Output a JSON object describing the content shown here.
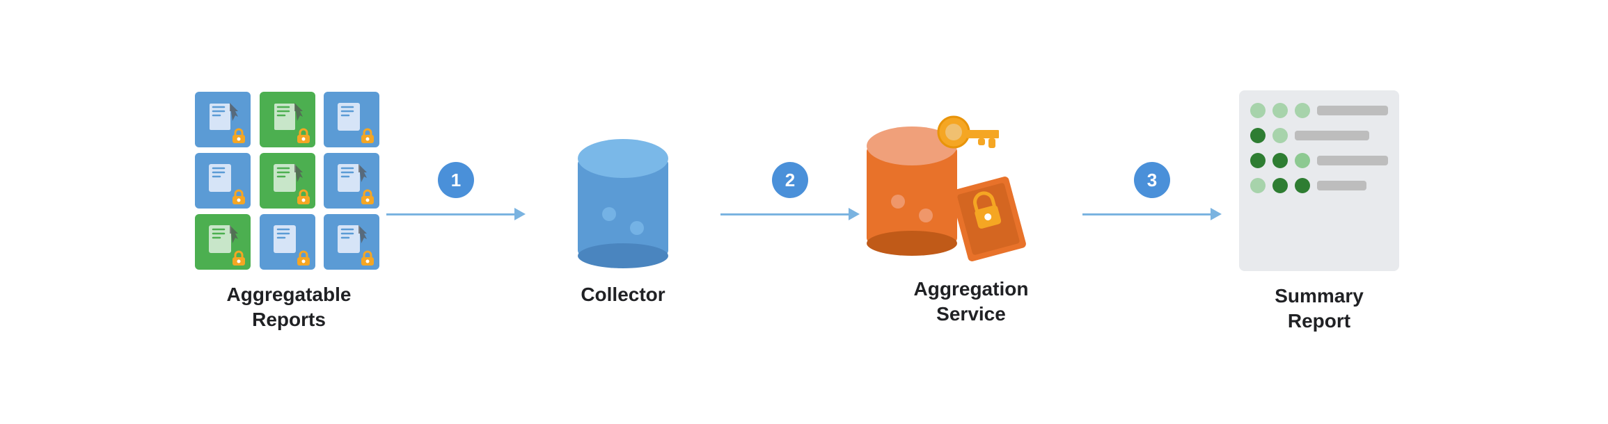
{
  "diagram": {
    "nodes": [
      {
        "id": "aggregatable-reports",
        "label": "Aggregatable\nReports"
      },
      {
        "id": "collector",
        "label": "Collector"
      },
      {
        "id": "aggregation-service",
        "label": "Aggregation\nService"
      },
      {
        "id": "summary-report",
        "label": "Summary\nReport"
      }
    ],
    "arrows": [
      {
        "id": "arrow-1",
        "step": "1"
      },
      {
        "id": "arrow-2",
        "step": "2"
      },
      {
        "id": "arrow-3",
        "step": "3"
      }
    ]
  },
  "summary_rows": [
    {
      "dots": [
        "light",
        "light",
        "light"
      ],
      "bar": "long"
    },
    {
      "dots": [
        "dark",
        "light"
      ],
      "bar": "med"
    },
    {
      "dots": [
        "dark",
        "dark",
        "light"
      ],
      "bar": "short"
    },
    {
      "dots": [
        "light",
        "dark",
        "dark"
      ],
      "bar": "med"
    }
  ]
}
